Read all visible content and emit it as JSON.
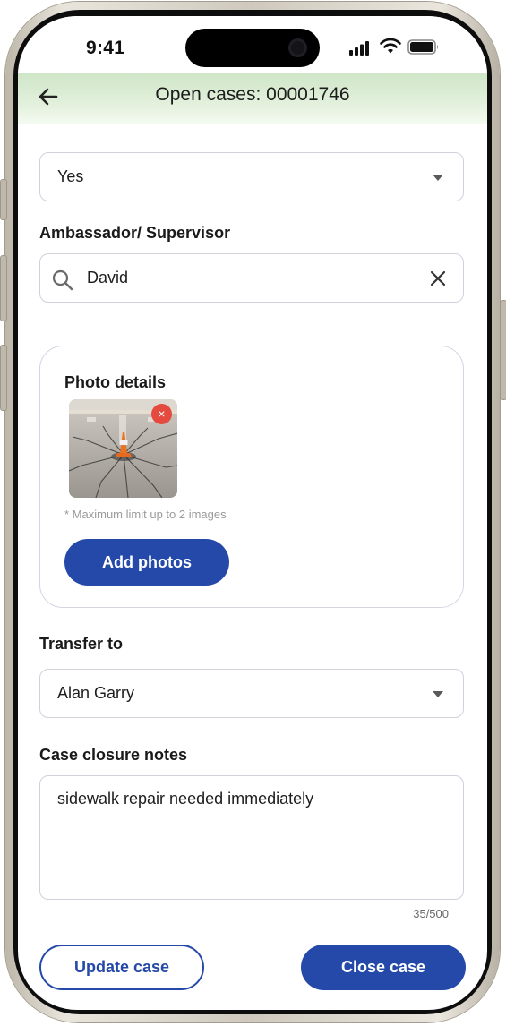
{
  "status_bar": {
    "time": "9:41"
  },
  "header": {
    "title": "Open cases: 00001746"
  },
  "form": {
    "first_select_value": "Yes",
    "ambassador": {
      "label": "Ambassador/ Supervisor",
      "value": "David"
    },
    "photo": {
      "title": "Photo details",
      "note": "* Maximum limit up to 2 images",
      "remove_symbol": "×",
      "add_button": "Add photos"
    },
    "transfer": {
      "label": "Transfer to",
      "value": "Alan Garry"
    },
    "notes": {
      "label": "Case closure notes",
      "value": "sidewalk repair needed immediately",
      "counter": "35/500"
    }
  },
  "actions": {
    "update": "Update case",
    "close": "Close case"
  },
  "colors": {
    "primary": "#2449a8",
    "remove_badge": "#e44a3e",
    "header_tint": "#cfe6c8"
  }
}
